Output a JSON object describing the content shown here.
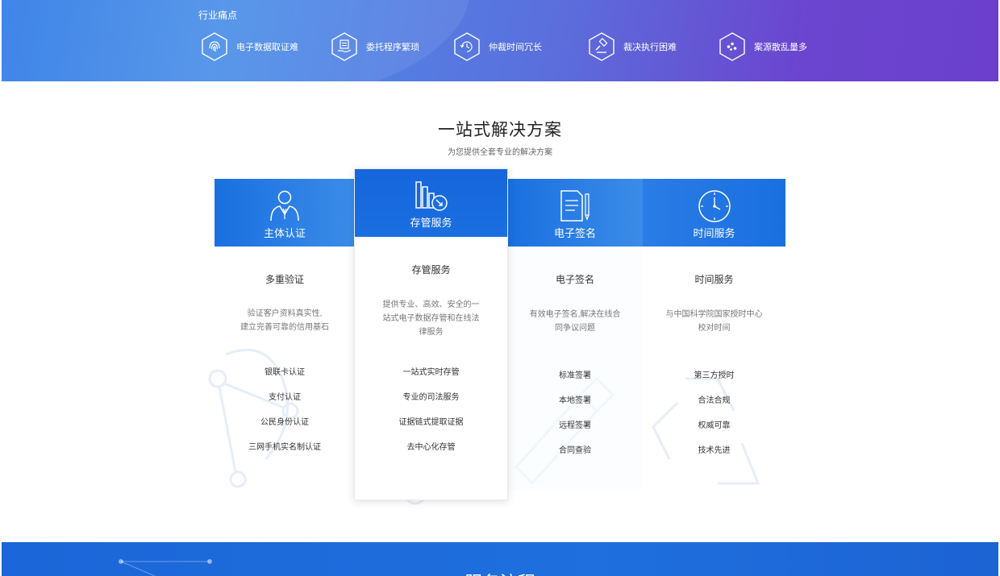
{
  "banner": {
    "title": "行业痛点",
    "items": [
      {
        "label": "电子数据取证难",
        "icon": "fingerprint-icon"
      },
      {
        "label": "委托程序繁琐",
        "icon": "document-hand-icon"
      },
      {
        "label": "仲裁时间冗长",
        "icon": "clock-refresh-icon"
      },
      {
        "label": "裁决执行困难",
        "icon": "gavel-icon"
      },
      {
        "label": "案源散乱量多",
        "icon": "scatter-dots-icon"
      }
    ]
  },
  "solution": {
    "title": "一站式解决方案",
    "subtitle": "为您提供全套专业的解决方案",
    "cards": [
      {
        "head": "主体认证",
        "icon": "person-icon",
        "name": "多重验证",
        "desc": [
          "验证客户资料真实性,",
          "建立完善可靠的信用基石"
        ],
        "features": [
          "银联卡认证",
          "支付认证",
          "公民身份认证",
          "三网手机实名制认证"
        ]
      },
      {
        "head": "存管服务",
        "icon": "archive-chart-icon",
        "name": "存管服务",
        "desc": [
          "提供专业、高效、安全的一",
          "站式电子数据存管和在线法",
          "律服务"
        ],
        "features": [
          "一站式实时存管",
          "专业的司法服务",
          "证据链式提取证据",
          "去中心化存管"
        ]
      },
      {
        "head": "电子签名",
        "icon": "document-pen-icon",
        "name": "电子签名",
        "desc": [
          "有效电子签名,解决在线合",
          "同争议问题"
        ],
        "features": [
          "标准签署",
          "本地签署",
          "远程签署",
          "合同查验"
        ]
      },
      {
        "head": "时间服务",
        "icon": "clock-icon",
        "name": "时间服务",
        "desc": [
          "与中国科学院国家授时中心",
          "校对时间"
        ],
        "features": [
          "第三方授时",
          "合法合规",
          "权威可靠",
          "技术先进"
        ]
      }
    ]
  },
  "bottom": {
    "title": "服务流程"
  },
  "colors": {
    "accent": "#1a6fe0",
    "banner_start": "#2f7be6",
    "banner_end": "#6a40cc"
  }
}
